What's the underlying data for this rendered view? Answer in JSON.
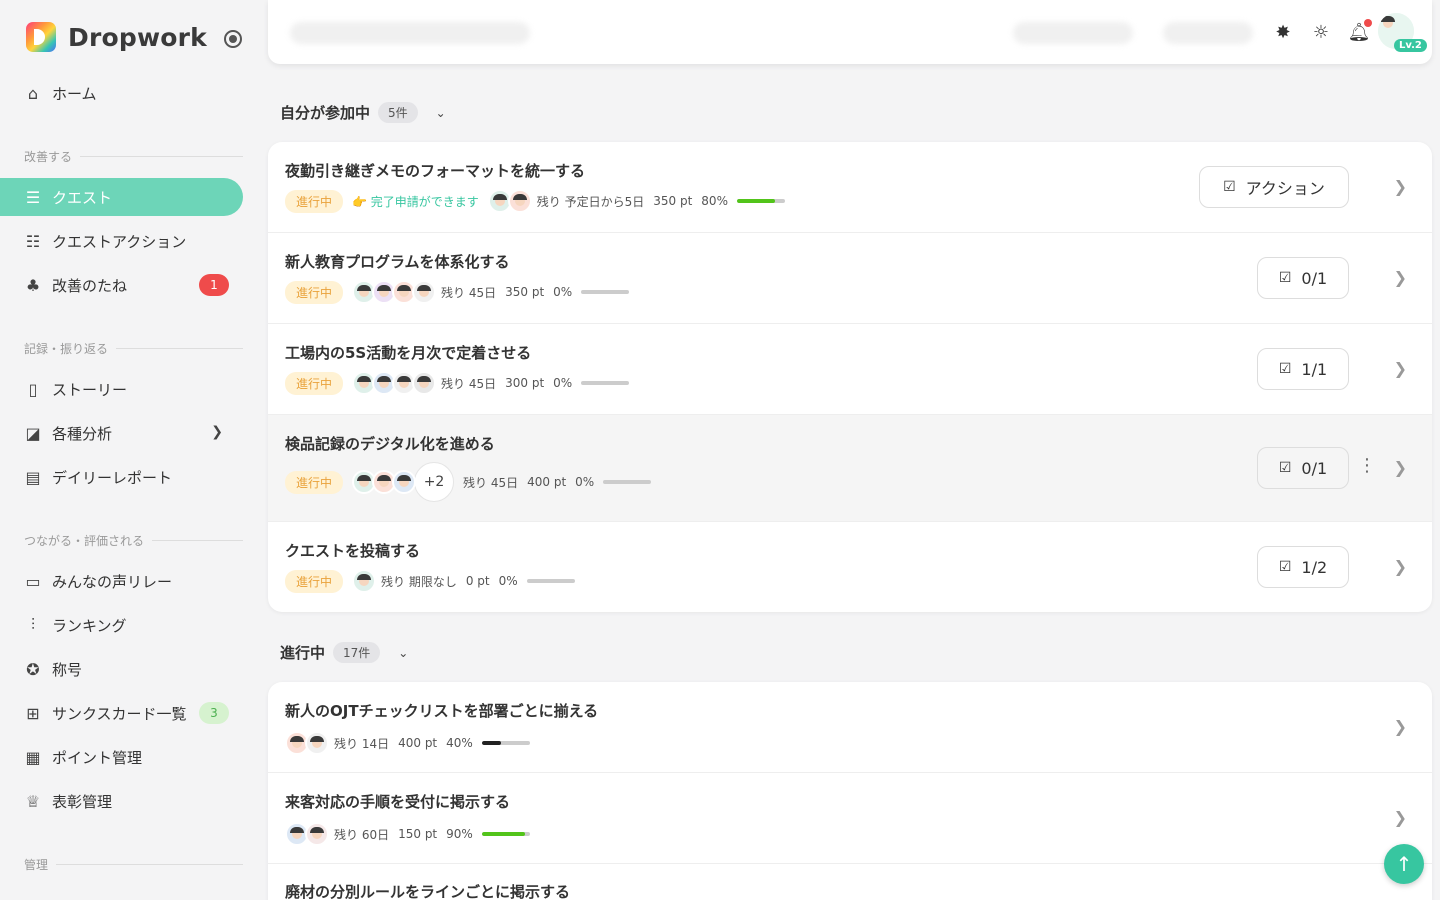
{
  "brand": {
    "name": "Dropwork"
  },
  "sidebar": {
    "home": "ホーム",
    "sections": {
      "improve": "改善する",
      "record": "記録・振り返る",
      "connect": "つながる・評価される",
      "admin": "管理"
    },
    "items": {
      "quest": "クエスト",
      "quest_action": "クエストアクション",
      "seeds": "改善のたね",
      "seeds_badge": "1",
      "story": "ストーリー",
      "analysis": "各種分析",
      "daily": "デイリーレポート",
      "voice": "みんなの声リレー",
      "ranking": "ランキング",
      "title": "称号",
      "thanks": "サンクスカード一覧",
      "thanks_badge": "3",
      "points": "ポイント管理",
      "award": "表彰管理"
    }
  },
  "topbar": {
    "level": "Lv.2"
  },
  "groups": {
    "mine": {
      "label": "自分が参加中",
      "count": "5件"
    },
    "progress": {
      "label": "進行中",
      "count": "17件"
    }
  },
  "colors": {
    "accent": "#37c6a0",
    "active_nav": "#6dd5b8",
    "badge_red": "#ef4b4b",
    "status_bg": "#fff2d4",
    "status_text": "#e9a23b"
  },
  "mine_rows": [
    {
      "title": "夜勤引き継ぎメモのフォーマットを統一する",
      "status": "進行中",
      "ready": "完了申請ができます",
      "remain": "残り 予定日から5日",
      "pt": "350 pt",
      "pct": "80%",
      "progress": 0.8,
      "action": "アクション"
    },
    {
      "title": "新人教育プログラムを体系化する",
      "status": "進行中",
      "remain": "残り 45日",
      "pt": "350 pt",
      "pct": "0%",
      "progress": 0,
      "action": "0/1"
    },
    {
      "title": "工場内の5S活動を月次で定着させる",
      "status": "進行中",
      "remain": "残り 45日",
      "pt": "300 pt",
      "pct": "0%",
      "progress": 0,
      "action": "1/1"
    },
    {
      "title": "検品記録のデジタル化を進める",
      "status": "進行中",
      "more": "+2",
      "remain": "残り 45日",
      "pt": "400 pt",
      "pct": "0%",
      "progress": 0,
      "action": "0/1"
    },
    {
      "title": "クエストを投稿する",
      "status": "進行中",
      "remain": "残り 期限なし",
      "pt": "0 pt",
      "pct": "0%",
      "progress": 0,
      "action": "1/2"
    }
  ],
  "progress_rows": [
    {
      "title": "新人のOJTチェックリストを部署ごとに揃える",
      "remain": "残り 14日",
      "pt": "400 pt",
      "pct": "40%",
      "progress": 0.4
    },
    {
      "title": "来客対応の手順を受付に掲示する",
      "remain": "残り 60日",
      "pt": "150 pt",
      "pct": "90%",
      "progress": 0.9
    },
    {
      "title": "廃材の分別ルールをラインごとに掲示する"
    }
  ]
}
